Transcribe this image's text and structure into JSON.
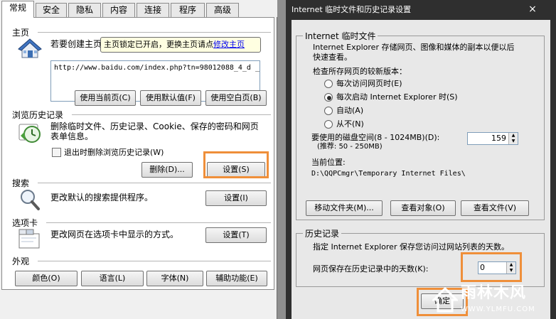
{
  "left_dialog": {
    "tabs": [
      "常规",
      "安全",
      "隐私",
      "内容",
      "连接",
      "程序",
      "高级"
    ],
    "home": {
      "title": "主页",
      "desc": "若要创建主页",
      "url": "http://www.baidu.com/index.php?tn=98012088_4_d _",
      "tooltip_text": "主页锁定已开启，更换主页请点",
      "tooltip_link": "修改主页",
      "buttons": [
        "使用当前页(C)",
        "使用默认值(F)",
        "使用空白页(B)"
      ]
    },
    "history": {
      "title": "浏览历史记录",
      "desc_line1": "删除临时文件、历史记录、Cookie、保存的密码和网页",
      "desc_line2": "表单信息。",
      "checkbox_label": "退出时删除浏览历史记录(W)",
      "delete_button": "删除(D)...",
      "settings_button": "设置(S)"
    },
    "search": {
      "title": "搜索",
      "desc": "更改默认的搜索提供程序。",
      "settings_button": "设置(I)"
    },
    "tabs_section": {
      "title": "选项卡",
      "desc": "更改网页在选项卡中显示的方式。",
      "settings_button": "设置(T)"
    },
    "appearance": {
      "title": "外观",
      "buttons": [
        "颜色(O)",
        "语言(L)",
        "字体(N)",
        "辅助功能(E)"
      ]
    },
    "highlight_color": "#ef8f3a"
  },
  "right_dialog": {
    "title": "Internet 临时文件和历史记录设置",
    "close_glyph": "×",
    "temp_files": {
      "group_title": "Internet 临时文件",
      "desc_line1": "Internet Explorer 存储网页、图像和媒体的副本以便以后",
      "desc_line2": "快速查看。",
      "check_label": "检查所存网页的较新版本：",
      "radios": [
        {
          "label": "每次访问网页时(E)",
          "checked": false
        },
        {
          "label": "每次启动 Internet Explorer 时(S)",
          "checked": true
        },
        {
          "label": "自动(A)",
          "checked": false
        },
        {
          "label": "从不(N)",
          "checked": false
        }
      ],
      "disk_label_line1": "要使用的磁盘空间(8 - 1024MB)(D):",
      "disk_label_line2": "(推荐: 50 - 250MB)",
      "disk_value": "159",
      "location_label": "当前位置:",
      "location_path": "D:\\QQPCmgr\\Temporary Internet Files\\",
      "buttons": [
        "移动文件夹(M)...",
        "查看对象(O)",
        "查看文件(V)"
      ]
    },
    "history": {
      "group_title": "历史记录",
      "desc": "指定 Internet Explorer 保存您访问过网站列表的天数。",
      "days_label": "网页保存在历史记录中的天数(K):",
      "days_value": "0"
    },
    "ok_button": "确定"
  },
  "watermark": {
    "main": "雨林木风",
    "url": "WWW.YLMFU.COM"
  }
}
